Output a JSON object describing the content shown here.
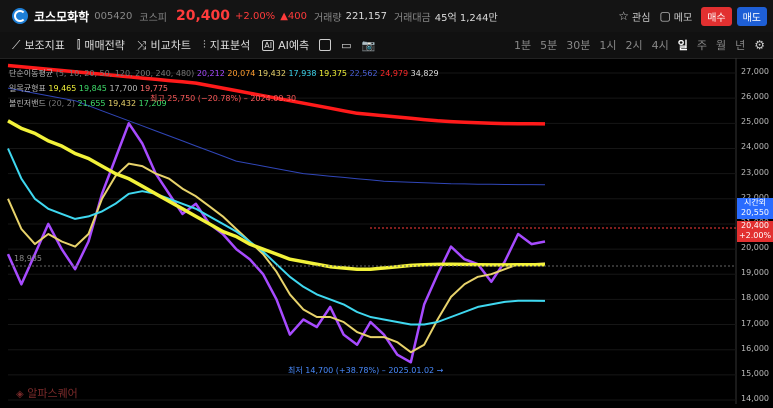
{
  "header": {
    "name": "코스모화학",
    "code": "005420",
    "market": "코스피",
    "price": "20,400",
    "change_pct": "+2.00%",
    "change_amt": "▲400",
    "volume_label": "거래량",
    "volume": "221,157",
    "amount_label": "거래대금",
    "amount": "45억 1,244만",
    "watch_label": "관심",
    "memo_label": "메모",
    "buy_label": "매수",
    "sell_label": "매도"
  },
  "toolbar": {
    "indicators_label": "보조지표",
    "strategy_label": "매매전략",
    "compare_label": "비교차트",
    "analysis_label": "지표분석",
    "ai_label": "AI예측",
    "periods": [
      "1분",
      "5분",
      "30분",
      "1시",
      "2시",
      "4시",
      "일",
      "주",
      "월",
      "년"
    ],
    "active_period": "일"
  },
  "legend": {
    "ma_label": "단순이동평균",
    "ma_params": "(5, 10, 20, 50, 120, 200, 240, 480)",
    "ma_values": [
      "20,212",
      "20,074",
      "19,432",
      "17,938",
      "19,375",
      "22,562",
      "24,979",
      "34,829"
    ],
    "ichimoku_label": "일목균형표",
    "ichimoku_values": [
      "19,465",
      "19,845",
      "17,700",
      "19,775"
    ],
    "bollinger_label": "볼린저밴드",
    "bollinger_params": "(20, 2)",
    "bollinger_values": [
      "21,655",
      "19,432",
      "17,209"
    ]
  },
  "annotations": {
    "high": "최고 25,750 (−20.78%) – 2024.09.30",
    "low": "최저 14,700 (+38.78%) – 2025.01.02 →",
    "left_price": "18,935",
    "time_tag_label": "시간외",
    "time_tag_price": "20,550",
    "price_tag": "20,400",
    "price_tag_pct": "+2.00%"
  },
  "watermark": "알파스퀘어",
  "colors": {
    "up": "#ff3b3b",
    "down": "#2a6cff",
    "buy": "#e23030",
    "sell": "#1e5fd6"
  },
  "chart_data": {
    "type": "line",
    "y_axis_labels": [
      "27,000",
      "26,000",
      "25,000",
      "24,000",
      "23,000",
      "22,000",
      "21,000",
      "20,000",
      "19,000",
      "18,000",
      "17,000",
      "16,000",
      "15,000",
      "14,000"
    ],
    "ylim": [
      14000,
      27200
    ],
    "series": [
      {
        "name": "5",
        "values": [
          19800,
          18600,
          19800,
          21000,
          20000,
          19200,
          20300,
          22200,
          23600,
          25000,
          24200,
          23000,
          22200,
          21400,
          21800,
          21000,
          20600,
          20000,
          19600,
          19000,
          18000,
          16600,
          17200,
          16900,
          17700,
          16600,
          16200,
          17100,
          16600,
          15800,
          15500,
          17800,
          19000,
          20100,
          19600,
          19400,
          18700,
          19500,
          20600,
          20200,
          20300
        ]
      },
      {
        "name": "20",
        "values": [
          22000,
          20800,
          20200,
          20600,
          20300,
          20100,
          20600,
          22000,
          22900,
          23400,
          23300,
          23000,
          22800,
          22400,
          22100,
          21700,
          21300,
          20800,
          20300,
          19800,
          19100,
          18200,
          17600,
          17300,
          17300,
          17100,
          16700,
          16500,
          16500,
          16300,
          15900,
          16200,
          17200,
          18100,
          18600,
          18900,
          19000,
          19200,
          19400,
          19400,
          19430
        ]
      },
      {
        "name": "50",
        "values": [
          24000,
          22800,
          22000,
          21600,
          21400,
          21200,
          21300,
          21500,
          21800,
          22200,
          22300,
          22200,
          22000,
          21800,
          21600,
          21300,
          21000,
          20700,
          20300,
          19900,
          19400,
          18900,
          18500,
          18200,
          18000,
          17800,
          17500,
          17300,
          17200,
          17100,
          17000,
          17000,
          17100,
          17300,
          17500,
          17700,
          17800,
          17900,
          17950,
          17950,
          17940
        ]
      },
      {
        "name": "120",
        "values": [
          25100,
          24800,
          24600,
          24300,
          24100,
          23800,
          23600,
          23300,
          23000,
          22800,
          22500,
          22200,
          21900,
          21600,
          21300,
          21000,
          20700,
          20500,
          20200,
          20000,
          19800,
          19600,
          19500,
          19400,
          19300,
          19250,
          19200,
          19200,
          19250,
          19300,
          19350,
          19380,
          19390,
          19395,
          19390,
          19380,
          19370,
          19370,
          19375,
          19375,
          19375
        ]
      },
      {
        "name": "200",
        "values": [
          26400,
          26300,
          26200,
          26100,
          26000,
          25900,
          25700,
          25500,
          25300,
          25100,
          24900,
          24700,
          24500,
          24300,
          24100,
          23900,
          23700,
          23500,
          23400,
          23300,
          23200,
          23100,
          23000,
          22950,
          22900,
          22850,
          22800,
          22750,
          22700,
          22680,
          22660,
          22640,
          22620,
          22600,
          22590,
          22580,
          22575,
          22570,
          22566,
          22563,
          22562
        ]
      },
      {
        "name": "240",
        "values": [
          27300,
          27250,
          27200,
          27150,
          27100,
          27050,
          27000,
          26950,
          26900,
          26850,
          26800,
          26750,
          26700,
          26650,
          26600,
          26500,
          26400,
          26300,
          26200,
          26100,
          26000,
          25900,
          25800,
          25700,
          25600,
          25500,
          25400,
          25350,
          25300,
          25250,
          25200,
          25150,
          25100,
          25070,
          25040,
          25020,
          25000,
          24990,
          24985,
          24980,
          24979
        ]
      }
    ]
  }
}
